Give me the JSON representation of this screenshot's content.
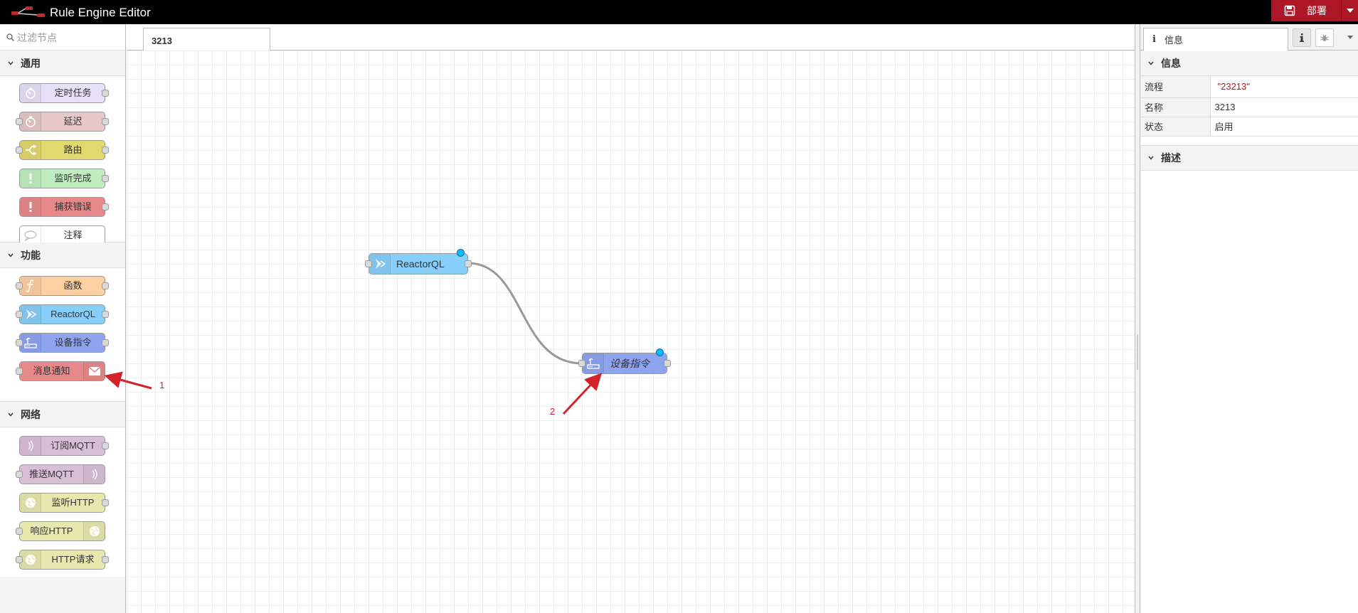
{
  "header": {
    "title": "Rule Engine Editor",
    "deploy_label": "部署"
  },
  "palette": {
    "search_placeholder": "过滤节点",
    "categories": [
      {
        "name": "通用",
        "nodes": [
          {
            "label": "定时任务",
            "color": "#e6e0f8",
            "icon": "timer-icon"
          },
          {
            "label": "延迟",
            "color": "#e6c8c8",
            "icon": "timer-icon"
          },
          {
            "label": "路由",
            "color": "#e2d96e",
            "icon": "switch-icon"
          },
          {
            "label": "监听完成",
            "color": "#c0edc0",
            "icon": "alert-icon"
          },
          {
            "label": "捕获错误",
            "color": "#e7898a",
            "icon": "alert-icon"
          },
          {
            "label": "注释",
            "color": "#ffffff",
            "icon": "comment-icon"
          }
        ]
      },
      {
        "name": "功能",
        "nodes": [
          {
            "label": "函数",
            "color": "#fdd0a2",
            "icon": "function-icon"
          },
          {
            "label": "ReactorQL",
            "color": "#87cefa",
            "icon": "reactor-icon"
          },
          {
            "label": "设备指令",
            "color": "#8fa4ef",
            "icon": "device-icon"
          },
          {
            "label": "消息通知",
            "color": "#e7898a",
            "icon": "envelope-icon"
          }
        ]
      },
      {
        "name": "网络",
        "nodes": [
          {
            "label": "订阅MQTT",
            "color": "#d8bfd8",
            "icon": "mqtt-icon"
          },
          {
            "label": "推送MQTT",
            "color": "#d8bfd8",
            "icon": "mqtt-icon"
          },
          {
            "label": "监听HTTP",
            "color": "#e7e7ae",
            "icon": "web-icon"
          },
          {
            "label": "响应HTTP",
            "color": "#e7e7ae",
            "icon": "web-icon"
          },
          {
            "label": "HTTP请求",
            "color": "#e7e7ae",
            "icon": "web-icon"
          }
        ]
      }
    ]
  },
  "workspace": {
    "tab_label": "3213",
    "nodes": [
      {
        "label": "ReactorQL",
        "color": "#87cefa"
      },
      {
        "label": "设备指令",
        "color": "#8fa4ef"
      }
    ],
    "annotations": [
      "1",
      "2"
    ]
  },
  "sidebar": {
    "tab_label": "信息",
    "info_glyph": "i",
    "sections": {
      "info": "信息",
      "description": "描述"
    },
    "properties": [
      {
        "key": "流程",
        "value": "\"23213\""
      },
      {
        "key": "名称",
        "value": "3213"
      },
      {
        "key": "状态",
        "value": "启用"
      }
    ]
  }
}
